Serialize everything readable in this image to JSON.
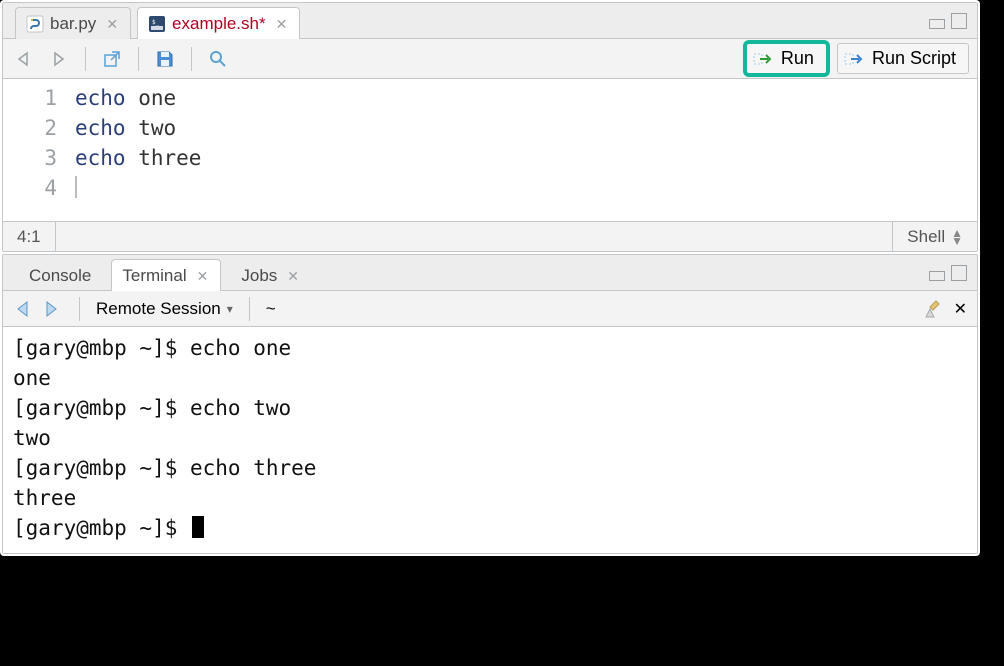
{
  "editor_pane": {
    "tabs": [
      {
        "label": "bar.py",
        "icon": "python-file-icon",
        "active": false,
        "dirty": false
      },
      {
        "label": "example.sh*",
        "icon": "shell-file-icon",
        "active": true,
        "dirty": true
      }
    ],
    "toolbar": {
      "run_label": "Run",
      "run_script_label": "Run Script"
    },
    "code": {
      "lines": [
        {
          "n": "1",
          "kw": "echo",
          "rest": " one"
        },
        {
          "n": "2",
          "kw": "echo",
          "rest": " two"
        },
        {
          "n": "3",
          "kw": "echo",
          "rest": " three"
        },
        {
          "n": "4",
          "kw": "",
          "rest": ""
        }
      ]
    },
    "status": {
      "pos": "4:1",
      "lang": "Shell"
    }
  },
  "console_pane": {
    "tabs": [
      {
        "label": "Console",
        "active": false,
        "closable": false
      },
      {
        "label": "Terminal",
        "active": true,
        "closable": true
      },
      {
        "label": "Jobs",
        "active": false,
        "closable": true
      }
    ],
    "toolbar": {
      "session_label": "Remote Session",
      "cwd": "~"
    },
    "output": [
      "[gary@mbp ~]$ echo one",
      "one",
      "[gary@mbp ~]$ echo two",
      "two",
      "[gary@mbp ~]$ echo three",
      "three",
      "[gary@mbp ~]$ "
    ]
  }
}
